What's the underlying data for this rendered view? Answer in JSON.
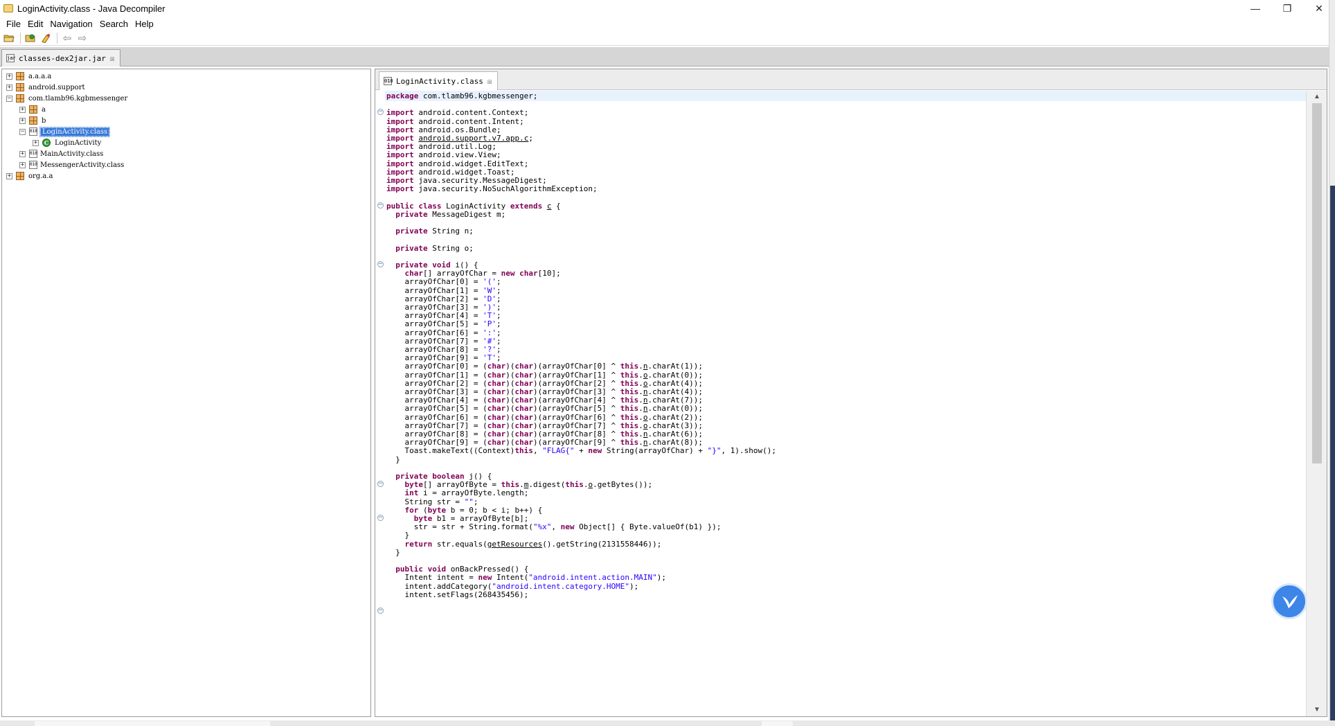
{
  "window": {
    "title": "LoginActivity.class - Java Decompiler",
    "controls": {
      "minimize": "—",
      "restore": "❐",
      "close": "✕"
    }
  },
  "menu": [
    "File",
    "Edit",
    "Navigation",
    "Search",
    "Help"
  ],
  "toolbar": {
    "buttons": [
      "open-file-icon",
      "open-type-icon",
      "open-type-hierarchy-icon",
      "back-icon",
      "forward-icon"
    ],
    "glyphs": {
      "back": "⇦",
      "forward": "⇨"
    }
  },
  "file_tab": {
    "label": "classes-dex2jar.jar",
    "close": "☒",
    "icon_text": "jar"
  },
  "tree": {
    "nodes": [
      {
        "label": "a.a.a.a",
        "expander": "+",
        "type": "package",
        "depth": 0
      },
      {
        "label": "android.support",
        "expander": "+",
        "type": "package",
        "depth": 0
      },
      {
        "label": "com.tlamb96.kgbmessenger",
        "expander": "−",
        "type": "package",
        "depth": 0
      },
      {
        "label": "a",
        "expander": "+",
        "type": "package",
        "depth": 1
      },
      {
        "label": "b",
        "expander": "+",
        "type": "package",
        "depth": 1
      },
      {
        "label": "LoginActivity.class",
        "expander": "−",
        "type": "classfile",
        "depth": 1,
        "selected": true
      },
      {
        "label": "LoginActivity",
        "expander": "+",
        "type": "class",
        "depth": 2
      },
      {
        "label": "MainActivity.class",
        "expander": "+",
        "type": "classfile",
        "depth": 1
      },
      {
        "label": "MessengerActivity.class",
        "expander": "+",
        "type": "classfile",
        "depth": 1
      },
      {
        "label": "org.a.a",
        "expander": "+",
        "type": "package",
        "depth": 0
      }
    ],
    "class_icon_text": "010",
    "clazz_icon_text": "C"
  },
  "editor": {
    "tab": {
      "label": "LoginActivity.class",
      "close": "☒",
      "icon_text": "010"
    },
    "code": [
      "<span class=\"kw\">package</span> com.tlamb96.kgbmessenger;",
      "",
      "<span class=\"kw\">import</span> android.content.Context;",
      "<span class=\"kw\">import</span> android.content.Intent;",
      "<span class=\"kw\">import</span> android.os.Bundle;",
      "<span class=\"kw\">import</span> <span class=\"ul\">android.support.v7.app.c</span>;",
      "<span class=\"kw\">import</span> android.util.Log;",
      "<span class=\"kw\">import</span> android.view.View;",
      "<span class=\"kw\">import</span> android.widget.EditText;",
      "<span class=\"kw\">import</span> android.widget.Toast;",
      "<span class=\"kw\">import</span> java.security.MessageDigest;",
      "<span class=\"kw\">import</span> java.security.NoSuchAlgorithmException;",
      "",
      "<span class=\"kw\">public class</span> LoginActivity <span class=\"kw\">extends</span> <span class=\"ul\">c</span> {",
      "  <span class=\"kw\">private</span> MessageDigest m;",
      "",
      "  <span class=\"kw\">private</span> String n;",
      "",
      "  <span class=\"kw\">private</span> String o;",
      "",
      "  <span class=\"kw\">private void</span> i() {",
      "    <span class=\"kw\">char</span>[] arrayOfChar = <span class=\"kw\">new char</span>[10];",
      "    arrayOfChar[0] = <span class=\"str\">'('</span>;",
      "    arrayOfChar[1] = <span class=\"str\">'W'</span>;",
      "    arrayOfChar[2] = <span class=\"str\">'D'</span>;",
      "    arrayOfChar[3] = <span class=\"str\">')'</span>;",
      "    arrayOfChar[4] = <span class=\"str\">'T'</span>;",
      "    arrayOfChar[5] = <span class=\"str\">'P'</span>;",
      "    arrayOfChar[6] = <span class=\"str\">':'</span>;",
      "    arrayOfChar[7] = <span class=\"str\">'#'</span>;",
      "    arrayOfChar[8] = <span class=\"str\">'?'</span>;",
      "    arrayOfChar[9] = <span class=\"str\">'T'</span>;",
      "    arrayOfChar[0] = (<span class=\"kw\">char</span>)(<span class=\"kw\">char</span>)(arrayOfChar[0] ^ <span class=\"kw\">this</span>.<span class=\"ul\">n</span>.charAt(1));",
      "    arrayOfChar[1] = (<span class=\"kw\">char</span>)(<span class=\"kw\">char</span>)(arrayOfChar[1] ^ <span class=\"kw\">this</span>.<span class=\"ul\">o</span>.charAt(0));",
      "    arrayOfChar[2] = (<span class=\"kw\">char</span>)(<span class=\"kw\">char</span>)(arrayOfChar[2] ^ <span class=\"kw\">this</span>.<span class=\"ul\">o</span>.charAt(4));",
      "    arrayOfChar[3] = (<span class=\"kw\">char</span>)(<span class=\"kw\">char</span>)(arrayOfChar[3] ^ <span class=\"kw\">this</span>.<span class=\"ul\">n</span>.charAt(4));",
      "    arrayOfChar[4] = (<span class=\"kw\">char</span>)(<span class=\"kw\">char</span>)(arrayOfChar[4] ^ <span class=\"kw\">this</span>.<span class=\"ul\">n</span>.charAt(7));",
      "    arrayOfChar[5] = (<span class=\"kw\">char</span>)(<span class=\"kw\">char</span>)(arrayOfChar[5] ^ <span class=\"kw\">this</span>.<span class=\"ul\">n</span>.charAt(0));",
      "    arrayOfChar[6] = (<span class=\"kw\">char</span>)(<span class=\"kw\">char</span>)(arrayOfChar[6] ^ <span class=\"kw\">this</span>.<span class=\"ul\">o</span>.charAt(2));",
      "    arrayOfChar[7] = (<span class=\"kw\">char</span>)(<span class=\"kw\">char</span>)(arrayOfChar[7] ^ <span class=\"kw\">this</span>.<span class=\"ul\">o</span>.charAt(3));",
      "    arrayOfChar[8] = (<span class=\"kw\">char</span>)(<span class=\"kw\">char</span>)(arrayOfChar[8] ^ <span class=\"kw\">this</span>.<span class=\"ul\">n</span>.charAt(6));",
      "    arrayOfChar[9] = (<span class=\"kw\">char</span>)(<span class=\"kw\">char</span>)(arrayOfChar[9] ^ <span class=\"kw\">this</span>.<span class=\"ul\">n</span>.charAt(8));",
      "    Toast.makeText((Context)<span class=\"kw\">this</span>, <span class=\"str\">\"FLAG{\"</span> + <span class=\"kw\">new</span> String(arrayOfChar) + <span class=\"str\">\"}\"</span>, 1).show();",
      "  }",
      "",
      "  <span class=\"kw\">private boolean</span> j() {",
      "    <span class=\"kw\">byte</span>[] arrayOfByte = <span class=\"kw\">this</span>.<span class=\"ul\">m</span>.digest(<span class=\"kw\">this</span>.<span class=\"ul\">o</span>.getBytes());",
      "    <span class=\"kw\">int</span> i = arrayOfByte.length;",
      "    String str = <span class=\"str\">\"\"</span>;",
      "    <span class=\"kw\">for</span> (<span class=\"kw\">byte</span> b = 0; b &lt; i; b++) {",
      "      <span class=\"kw\">byte</span> b1 = arrayOfByte[b];",
      "      str = str + String.format(<span class=\"str\">\"%x\"</span>, <span class=\"kw\">new</span> Object[] { Byte.valueOf(b1) });",
      "    }",
      "    <span class=\"kw\">return</span> str.equals(<span class=\"ul\">getResources</span>().getString(2131558446));",
      "  }",
      "",
      "  <span class=\"kw\">public void</span> onBackPressed() {",
      "    Intent intent = <span class=\"kw\">new</span> Intent(<span class=\"str\">\"android.intent.action.MAIN\"</span>);",
      "    intent.addCategory(<span class=\"str\">\"android.intent.category.HOME\"</span>);",
      "    intent.setFlags(268435456);"
    ],
    "fold_markers": [
      2,
      13,
      20,
      46,
      50,
      61
    ],
    "highlighted_line": 0
  },
  "scrollbar": {
    "up": "▲",
    "down": "▼"
  },
  "colors": {
    "keyword": "#7f0055",
    "string": "#2a00ff",
    "selection": "#3478d8"
  }
}
